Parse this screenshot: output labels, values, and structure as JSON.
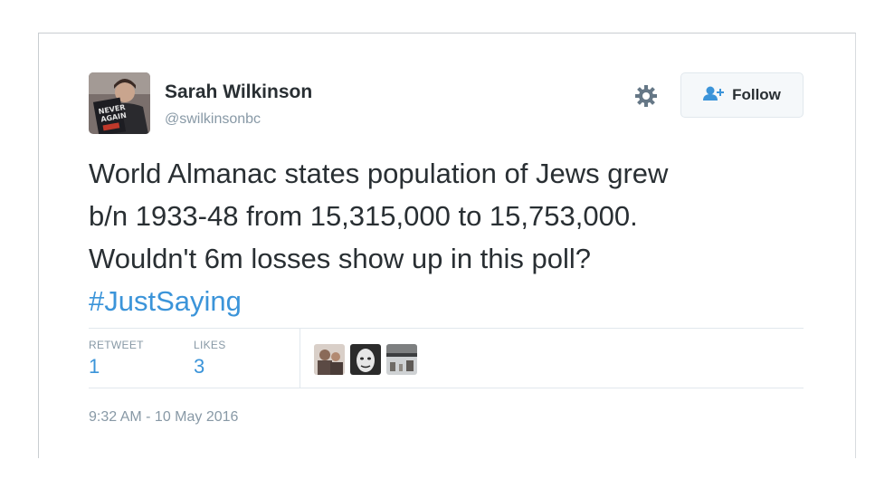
{
  "tweet": {
    "author": {
      "display_name": "Sarah Wilkinson",
      "handle": "@swilkinsonbc",
      "avatar_icon": "profile-photo"
    },
    "follow_button": {
      "label": "Follow",
      "icon": "add-user-icon"
    },
    "settings_icon": "gear-icon",
    "text_lines": [
      "World Almanac states population of Jews grew",
      "b/n 1933-48 from 15,315,000 to 15,753,000.",
      "Wouldn't 6m losses show up in this poll?"
    ],
    "hashtag": "#JustSaying",
    "stats": {
      "retweet_label": "RETWEET",
      "retweet_count": "1",
      "likes_label": "LIKES",
      "likes_count": "3"
    },
    "likers": [
      "liker-avatar-1",
      "liker-avatar-2",
      "liker-avatar-3"
    ],
    "timestamp": "9:32 AM - 10 May 2016"
  },
  "colors": {
    "text": "#292f33",
    "secondary": "#8899a6",
    "link": "#3b94d9",
    "border": "#e1e8ed",
    "button_bg": "#f5f8fa"
  }
}
